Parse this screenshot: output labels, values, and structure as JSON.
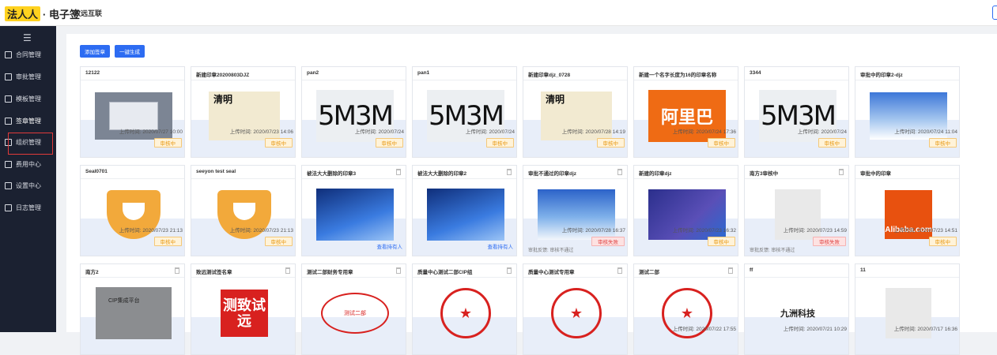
{
  "header": {
    "logo_mark": "法人人",
    "logo_text": "· 电子签",
    "company": "致远互联"
  },
  "sidebar": {
    "toggle": "☰",
    "items": [
      {
        "label": "合同管理",
        "icon": "document-icon"
      },
      {
        "label": "审批管理",
        "icon": "approval-icon"
      },
      {
        "label": "模板管理",
        "icon": "template-icon"
      },
      {
        "label": "签章管理",
        "icon": "seal-icon"
      },
      {
        "label": "组织管理",
        "icon": "organization-icon"
      },
      {
        "label": "费用中心",
        "icon": "fee-icon"
      },
      {
        "label": "设置中心",
        "icon": "gear-icon"
      },
      {
        "label": "日志管理",
        "icon": "log-icon"
      }
    ],
    "active_index": 3
  },
  "toolbar": {
    "add_seal": "添加签章",
    "generate": "一键生成"
  },
  "cards": [
    {
      "title": "12122",
      "img": "shot",
      "time": "上传时间: 2020/07/27 10:00",
      "badge": "审核中",
      "badge_type": "review"
    },
    {
      "title": "新建印章20200803DJZ",
      "img": "plant",
      "plant_text": "清明",
      "time": "上传时间: 2020/07/23 14:06",
      "badge": "审核中",
      "badge_type": "review"
    },
    {
      "title": "pan2",
      "img": "captcha",
      "captcha_text": "5M3M",
      "time": "上传时间: 2020/07/24",
      "badge": "审核中",
      "badge_type": "review"
    },
    {
      "title": "pan1",
      "img": "captcha",
      "captcha_text": "5M3M",
      "time": "上传时间: 2020/07/24",
      "badge": "审核中",
      "badge_type": "review"
    },
    {
      "title": "新建印章djz_0728",
      "img": "plant",
      "plant_text": "清明",
      "time": "上传时间: 2020/07/28 14:19",
      "badge": "审核中",
      "badge_type": "review"
    },
    {
      "title": "新建一个名字长度为16的印章名称",
      "img": "alibaba",
      "alibaba_text": "阿里巴",
      "time": "上传时间: 2020/07/24 17:36",
      "badge": "审核中",
      "badge_type": "review"
    },
    {
      "title": "3344",
      "img": "captcha",
      "captcha_text": "5M3M",
      "time": "上传时间: 2020/07/24",
      "badge": "审核中",
      "badge_type": "review"
    },
    {
      "title": "审批中的印章2-djz",
      "img": "sky",
      "time": "上传时间: 2020/07/24 11:04",
      "badge": "审核中",
      "badge_type": "review"
    },
    {
      "title": "Seal0701",
      "img": "orange",
      "time": "上传时间: 2020/07/23 21:13",
      "badge": "审核中",
      "badge_type": "review"
    },
    {
      "title": "seeyon test seal",
      "img": "orange",
      "time": "上传时间: 2020/07/23 21:13",
      "badge": "审核中",
      "badge_type": "review"
    },
    {
      "title": "被法大大删除的印章3",
      "img": "blue",
      "link": "查看持有人",
      "trash": true
    },
    {
      "title": "被法大大删除的印章2",
      "img": "blue",
      "link": "查看持有人",
      "trash": true
    },
    {
      "title": "审批不通过的印章djz",
      "img": "sky2",
      "time": "上传时间: 2020/07/28 16:37",
      "badge": "审核失败",
      "badge_type": "fail",
      "feedback": "审批反馈: 审核不通过",
      "trash": true
    },
    {
      "title": "新建的印章djz",
      "img": "purple",
      "time": "上传时间: 2020/07/23 16:32",
      "badge": "审核中",
      "badge_type": "review"
    },
    {
      "title": "南方3审核中",
      "img": "sketch",
      "time": "上传时间: 2020/07/23 14:59",
      "badge": "审核失败",
      "badge_type": "fail",
      "feedback": "审批反馈: 审核不通过",
      "trash": true
    },
    {
      "title": "审批中的印章",
      "img": "alibaba2",
      "alibaba_text": "Alibaba.com",
      "time": "上传时间: 2020/07/23 14:51",
      "badge": "审核中",
      "badge_type": "review"
    },
    {
      "title": "南方2",
      "img": "cip",
      "cip_text": "CIP集成平台",
      "trash": true
    },
    {
      "title": "致远测试签名章",
      "img": "redsq",
      "red_text": "测致试远",
      "trash": true
    },
    {
      "title": "测试二部财务专用章",
      "img": "redoval",
      "red_text": "测试二部",
      "trash": true
    },
    {
      "title": "质量中心测试二部CIP组",
      "img": "redcircle",
      "red_text": "★",
      "trash": true
    },
    {
      "title": "质量中心测试专用章",
      "img": "redcircle",
      "red_text": "★",
      "trash": true
    },
    {
      "title": "测试二部",
      "img": "redcircle",
      "red_text": "★",
      "time": "上传时间: 2020/07/22 17:55",
      "trash": true
    },
    {
      "title": "ff",
      "img": "logo9",
      "logo_text": "九洲科技",
      "time": "上传时间: 2020/07/21 10:29"
    },
    {
      "title": "11",
      "img": "sketch",
      "time": "上传时间: 2020/07/17 16:36"
    }
  ]
}
